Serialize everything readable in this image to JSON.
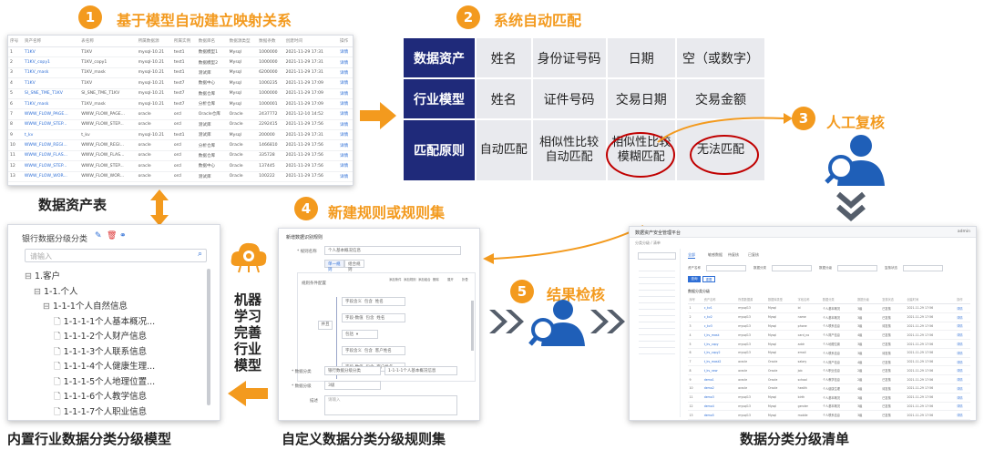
{
  "steps": [
    {
      "num": "1",
      "title": "基于模型自动建立映射关系"
    },
    {
      "num": "2",
      "title": "系统自动匹配"
    },
    {
      "num": "3",
      "title": "人工复核"
    },
    {
      "num": "4",
      "title": "新建规则或规则集"
    },
    {
      "num": "5",
      "title": "结果检核"
    }
  ],
  "captions": {
    "asset_table": "数据资产表",
    "builtin_model": "内置行业数据分类分级模型",
    "custom_rules": "自定义数据分类分级规则集",
    "result_list": "数据分类分级清单",
    "ml_text": [
      "机器",
      "学习",
      "完善",
      "行业",
      "模型"
    ]
  },
  "asset_table": {
    "headers": [
      "序号",
      "资产名称",
      "表名称",
      "所属数据源",
      "所属实例",
      "数据库名",
      "数据源类型",
      "数据条数",
      "创建时间",
      "",
      "操作"
    ],
    "rows": [
      [
        "1",
        "T1KV",
        "T1KV",
        "mysql-10.21",
        "test1",
        "数据模型1",
        "Mysql",
        "1000000",
        "2021-11-29 17:31",
        "",
        "详情"
      ],
      [
        "2",
        "T1KV_copy1",
        "T1KV_copy1",
        "mysql-10.21",
        "test1",
        "数据模型2",
        "Mysql",
        "1000000",
        "2021-11-29 17:31",
        "",
        "详情"
      ],
      [
        "3",
        "T1KV_mask",
        "T1KV_mask",
        "mysql-10.21",
        "test1",
        "测试库",
        "Mysql",
        "6200000",
        "2021-11-29 17:31",
        "",
        "详情"
      ],
      [
        "4",
        "T1KV",
        "T1KV",
        "mysql-10.21",
        "test7",
        "数据中心",
        "Mysql",
        "1000235",
        "2021-11-29 17:09",
        "",
        "详情"
      ],
      [
        "5",
        "SI_SNE_TME_T1KV",
        "SI_SNE_TME_T1KV",
        "mysql-10.21",
        "test7",
        "数据仓库",
        "Mysql",
        "1000000",
        "2021-11-29 17:09",
        "",
        "详情"
      ],
      [
        "6",
        "T1KV_mask",
        "T1KV_mask",
        "mysql-10.21",
        "test7",
        "分析仓库",
        "Mysql",
        "1000001",
        "2021-11-29 17:09",
        "",
        "详情"
      ],
      [
        "7",
        "WWW_FLOW_PAGE...",
        "WWW_FLOW_PAGE...",
        "oracle",
        "orcl",
        "Oracle仓库",
        "Oracle",
        "2437772",
        "2021-12-10 14:52",
        "",
        "详情"
      ],
      [
        "8",
        "WWW_FLOW_STEP...",
        "WWW_FLOW_STEP...",
        "oracle",
        "orcl",
        "测试库",
        "Oracle",
        "2292415",
        "2021-11-29 17:56",
        "",
        "详情"
      ],
      [
        "9",
        "t_kv",
        "t_kv",
        "mysql-10.21",
        "test1",
        "测试库",
        "Mysql",
        "200000",
        "2021-11-29 17:31",
        "",
        "详情"
      ],
      [
        "10",
        "WWW_FLOW_REGI...",
        "WWW_FLOW_REGI...",
        "oracle",
        "orcl",
        "分析仓库",
        "Oracle",
        "1466810",
        "2021-11-29 17:56",
        "",
        "详情"
      ],
      [
        "11",
        "WWW_FLOW_FLAS...",
        "WWW_FLOW_FLAS...",
        "oracle",
        "orcl",
        "数据仓库",
        "Oracle",
        "335728",
        "2021-11-29 17:56",
        "",
        "详情"
      ],
      [
        "12",
        "WWW_FLOW_STEP...",
        "WWW_FLOW_STEP...",
        "oracle",
        "orcl",
        "数据中心",
        "Oracle",
        "137445",
        "2021-11-29 17:56",
        "",
        "详情"
      ],
      [
        "13",
        "WWW_FLOW_WOR...",
        "WWW_FLOW_WOR...",
        "oracle",
        "orcl",
        "测试库",
        "Oracle",
        "100222",
        "2021-11-29 17:56",
        "",
        "详情"
      ]
    ]
  },
  "matrix": {
    "rows": [
      {
        "head": "数据资产",
        "cells": [
          "姓名",
          "身份证号码",
          "日期",
          "空（或数字）"
        ]
      },
      {
        "head": "行业模型",
        "cells": [
          "姓名",
          "证件号码",
          "交易日期",
          "交易金额"
        ]
      },
      {
        "head": "匹配原则",
        "cells": [
          "自动匹配",
          "相似性比较\n自动匹配",
          "相似性比较\n模糊匹配",
          "无法匹配"
        ]
      }
    ]
  },
  "tree": {
    "title": "银行数据分级分类",
    "search_placeholder": "请输入",
    "items": [
      "1.客户",
      "1-1.个人",
      "1-1-1个人自然信息",
      "1-1-1-1个人基本概况...",
      "1-1-1-2个人财产信息",
      "1-1-1-3个人联系信息",
      "1-1-1-4个人健康生理...",
      "1-1-1-5个人地理位置...",
      "1-1-1-6个人教学信息",
      "1-1-1-7个人职业信息"
    ]
  },
  "rules": {
    "title": "新增数据识别规则",
    "name_label": "* 规则名称",
    "name_value": "个人基本概况信息",
    "tabs": [
      "单一规则",
      "组合规则"
    ],
    "cond_label": "规则条件配置",
    "toolbar": [
      "添加条件",
      "添加规则",
      "添加组合",
      "删除",
      "展开",
      "折叠"
    ],
    "conditions": [
      "字段含义  包含  姓名",
      "字段-数值  包含  姓名",
      "包括  ▾",
      "字段含义  包含  客户姓名",
      "字段-数值  包含  客户姓名"
    ],
    "and_label": "并且",
    "or_label": "或",
    "class_label": "* 数据分类",
    "class_value1": "银行数据分级分类",
    "class_value2": "1-1-1-1个人基本概况信息",
    "level_label": "* 数据分级",
    "level_value": "3级",
    "desc_label": "描述",
    "desc_placeholder": "请输入"
  },
  "result": {
    "app_title": "数据资产安全管理平台",
    "user": "admin",
    "breadcrumb": "分类分级 / 清单",
    "tabs": [
      "全部",
      "敏感数据",
      "待复核",
      "已复核"
    ],
    "filter_labels": [
      "资产名称",
      "数据分类",
      "数据分级",
      "复核状态"
    ],
    "buttons": [
      "查询",
      "重置"
    ],
    "list_title": "数据分类分级",
    "headers": [
      "序号",
      "资产名称",
      "所属数据源",
      "数据库类型",
      "字段名称",
      "数据分类",
      "数据分级",
      "复核状态",
      "创建时间",
      "操作"
    ],
    "rows": [
      [
        "1",
        "c_kv1",
        "mysql13",
        "Mysql",
        "id",
        "个人基本概况",
        "3级",
        "已复核",
        "2021-11-29 17:56",
        "详情"
      ],
      [
        "2",
        "c_kv2",
        "mysql13",
        "Mysql",
        "name",
        "个人基本概况",
        "3级",
        "已复核",
        "2021-11-29 17:56",
        "详情"
      ],
      [
        "3",
        "c_kv3",
        "mysql13",
        "Mysql",
        "phone",
        "个人联系信息",
        "3级",
        "待复核",
        "2021-11-29 17:56",
        "详情"
      ],
      [
        "4",
        "t_kv_mask",
        "mysql13",
        "Mysql",
        "card_no",
        "个人财产信息",
        "4级",
        "已复核",
        "2021-11-29 17:56",
        "详情"
      ],
      [
        "5",
        "t_kv_copy",
        "mysql13",
        "Mysql",
        "addr",
        "个人地理位置",
        "3级",
        "已复核",
        "2021-11-29 17:56",
        "详情"
      ],
      [
        "6",
        "t_kv_copy2",
        "mysql13",
        "Mysql",
        "email",
        "个人联系信息",
        "3级",
        "待复核",
        "2021-11-29 17:56",
        "详情"
      ],
      [
        "7",
        "t_kv_mask2",
        "oracle",
        "Oracle",
        "salary",
        "个人财产信息",
        "4级",
        "已复核",
        "2021-11-29 17:56",
        "详情"
      ],
      [
        "8",
        "t_kv_new",
        "oracle",
        "Oracle",
        "job",
        "个人职业信息",
        "2级",
        "已复核",
        "2021-11-29 17:56",
        "详情"
      ],
      [
        "9",
        "demo1",
        "oracle",
        "Oracle",
        "school",
        "个人教学信息",
        "2级",
        "已复核",
        "2021-11-29 17:56",
        "详情"
      ],
      [
        "10",
        "demo2",
        "oracle",
        "Oracle",
        "health",
        "个人健康生理",
        "4级",
        "待复核",
        "2021-11-29 17:56",
        "详情"
      ],
      [
        "11",
        "demo3",
        "mysql13",
        "Mysql",
        "birth",
        "个人基本概况",
        "3级",
        "已复核",
        "2021-11-29 17:56",
        "详情"
      ],
      [
        "12",
        "demo4",
        "mysql13",
        "Mysql",
        "gender",
        "个人基本概况",
        "3级",
        "已复核",
        "2021-11-29 17:56",
        "详情"
      ],
      [
        "13",
        "demo5",
        "mysql13",
        "Mysql",
        "mobile",
        "个人联系信息",
        "3级",
        "已复核",
        "2021-11-29 17:56",
        "详情"
      ],
      [
        "14",
        "demo6",
        "oracle",
        "Oracle",
        "account",
        "个人财产信息",
        "4级",
        "已复核",
        "2021-11-29 17:56",
        "详情"
      ]
    ]
  },
  "colors": {
    "orange": "#f39a1e",
    "navy": "#1f2a7a",
    "blue": "#1f5fb8",
    "gray_arrow": "#555e6b"
  }
}
